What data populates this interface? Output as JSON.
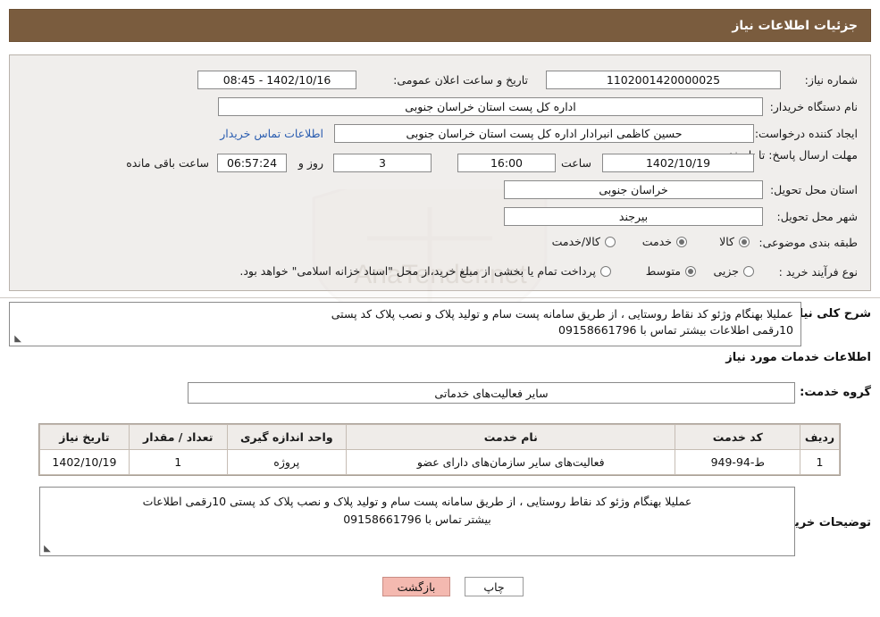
{
  "header": {
    "title": "جزئیات اطلاعات نیاز"
  },
  "info": {
    "need_number_label": "شماره نیاز:",
    "need_number_value": "1102001420000025",
    "public_announce_label": "تاریخ و ساعت اعلان عمومی:",
    "public_announce_value": "1402/10/16 - 08:45",
    "buyer_org_label": "نام دستگاه خریدار:",
    "buyer_org_value": "اداره کل پست استان خراسان جنوبی",
    "creator_label": "ایجاد کننده درخواست:",
    "creator_value": "حسین کاظمی انبرادار اداره کل پست استان خراسان جنوبی",
    "contact_link": "اطلاعات تماس خریدار",
    "deadline_label": "مهلت ارسال پاسخ: تا تاریخ:",
    "deadline_date": "1402/10/19",
    "deadline_time_label": "ساعت",
    "deadline_time": "16:00",
    "days_value": "3",
    "days_label": "روز و",
    "countdown_value": "06:57:24",
    "countdown_label": "ساعت باقی مانده",
    "province_label": "استان محل تحویل:",
    "province_value": "خراسان جنوبی",
    "city_label": "شهر محل تحویل:",
    "city_value": "بیرجند",
    "category_label": "طبقه بندی موضوعی:",
    "category_options": [
      {
        "label": "کالا",
        "selected": true
      },
      {
        "label": "خدمت",
        "selected": true
      },
      {
        "label": "کالا/خدمت",
        "selected": false
      }
    ],
    "process_label": "نوع فرآیند خرید :",
    "process_options": [
      {
        "label": "جزیی",
        "selected": false
      },
      {
        "label": "متوسط",
        "selected": true
      }
    ],
    "payment_note": "پرداخت تمام یا بخشی از مبلغ خرید،از محل \"اسناد خزانه اسلامی\" خواهد بود.",
    "payment_checked": false,
    "watermark_text": "AnaTender.net"
  },
  "description": {
    "label": "شرح کلی نیاز:",
    "text_line1": "عملیلا بهنگام وژئو کد نقاط روستایی ، از طریق سامانه پست سام و تولید پلاک و نصب پلاک کد پستی",
    "text_line2": "10رقمی اطلاعات بیشتر تماس با 09158661796"
  },
  "services": {
    "section_title": "اطلاعات خدمات مورد نیاز",
    "group_label": "گروه خدمت:",
    "group_value": "سایر فعالیت‌های خدماتی",
    "table": {
      "headers": [
        "ردیف",
        "کد خدمت",
        "نام خدمت",
        "واحد اندازه گیری",
        "تعداد / مقدار",
        "تاریخ نیاز"
      ],
      "rows": [
        [
          "1",
          "ط-94-949",
          "فعالیت‌های سایر سازمان‌های دارای عضو",
          "پروژه",
          "1",
          "1402/10/19"
        ]
      ]
    }
  },
  "notes": {
    "label": "توضیحات خریدار:",
    "line1": "عملیلا بهنگام وژئو کد نقاط روستایی ، از طریق سامانه پست سام و تولید پلاک و نصب پلاک کد پستی 10رقمی اطلاعات",
    "line2": "بیشتر تماس با 09158661796"
  },
  "footer": {
    "print_label": "چاپ",
    "back_label": "بازگشت"
  }
}
